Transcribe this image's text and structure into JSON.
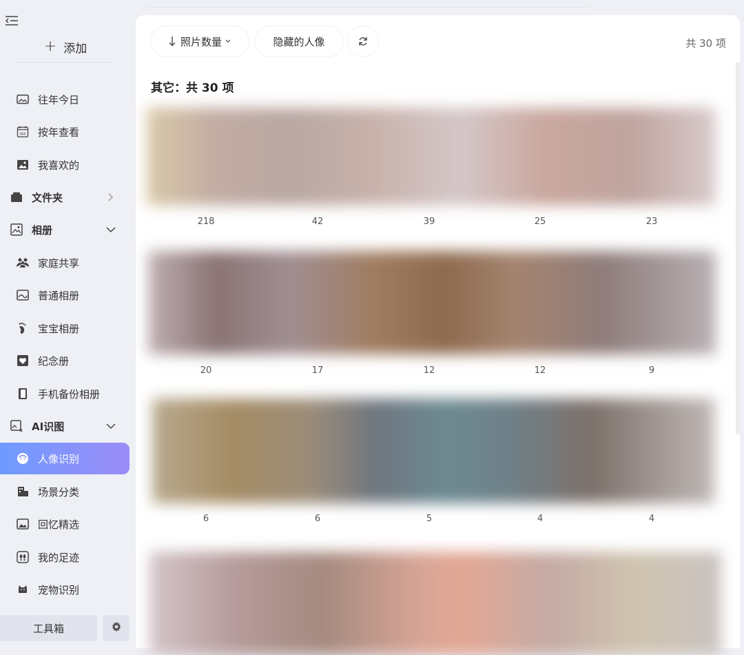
{
  "sidebar": {
    "add_label": "添加",
    "items": [
      {
        "label": "往年今日",
        "icon": "photo-icon"
      },
      {
        "label": "按年查看",
        "icon": "calendar-icon"
      },
      {
        "label": "我喜欢的",
        "icon": "image-icon"
      },
      {
        "label": "文件夹",
        "icon": "folder-icon"
      },
      {
        "label": "相册",
        "icon": "album-icon"
      },
      {
        "label": "家庭共享",
        "icon": "family-icon"
      },
      {
        "label": "普通相册",
        "icon": "album-normal-icon"
      },
      {
        "label": "宝宝相册",
        "icon": "footprint-icon"
      },
      {
        "label": "纪念册",
        "icon": "heart-icon"
      },
      {
        "label": "手机备份相册",
        "icon": "phone-icon"
      },
      {
        "label": "AI识图",
        "icon": "ai-image-icon"
      },
      {
        "label": "人像识别",
        "icon": "face-icon"
      },
      {
        "label": "场景分类",
        "icon": "scene-icon"
      },
      {
        "label": "回忆精选",
        "icon": "memory-icon"
      },
      {
        "label": "我的足迹",
        "icon": "footsteps-icon"
      },
      {
        "label": "宠物识别",
        "icon": "pet-icon"
      }
    ],
    "toolbox_label": "工具箱"
  },
  "toolbar": {
    "sort_label": "照片数量",
    "hidden_label": "隐藏的人像",
    "count_label": "共 30 项"
  },
  "section": {
    "title": "其它：共 30 项"
  },
  "rows": [
    {
      "counts": [
        "218",
        "42",
        "39",
        "25",
        "23"
      ]
    },
    {
      "counts": [
        "20",
        "17",
        "12",
        "12",
        "9"
      ]
    },
    {
      "counts": [
        "6",
        "6",
        "5",
        "4",
        "4"
      ]
    }
  ],
  "colors": {
    "accent_start": "#6f9bff",
    "accent_end": "#9b8cf7"
  }
}
